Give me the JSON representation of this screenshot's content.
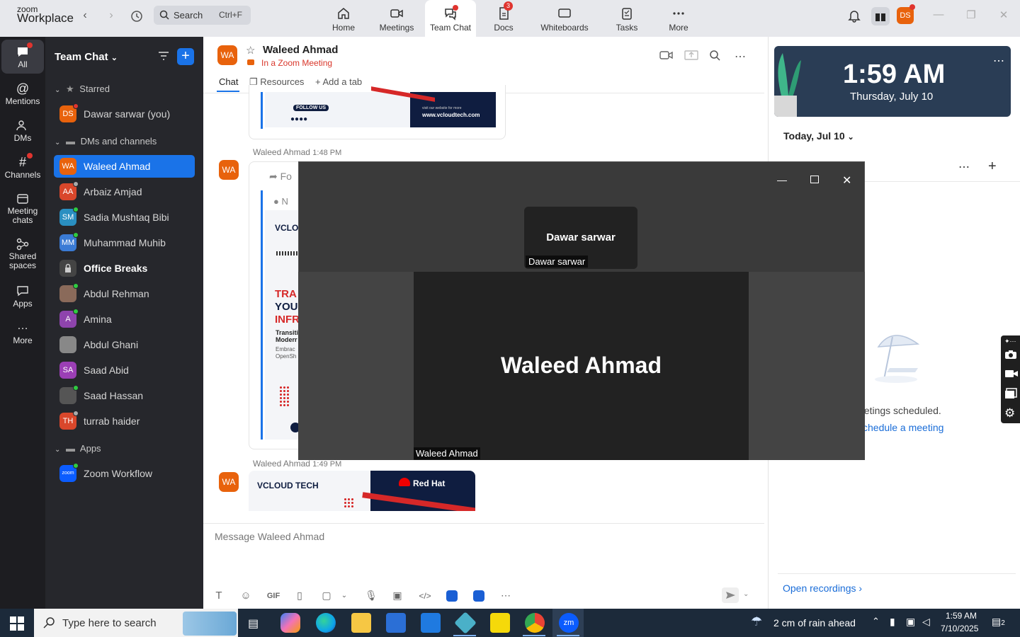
{
  "app": {
    "brand_small": "zoom",
    "brand_large": "Workplace"
  },
  "search": {
    "label": "Search",
    "shortcut": "Ctrl+F"
  },
  "nav_tabs": [
    {
      "label": "Home",
      "icon": "home-icon"
    },
    {
      "label": "Meetings",
      "icon": "video-icon"
    },
    {
      "label": "Team Chat",
      "icon": "chat-icon",
      "active": true
    },
    {
      "label": "Docs",
      "icon": "docs-icon",
      "badge": "3"
    },
    {
      "label": "Whiteboards",
      "icon": "whiteboard-icon"
    },
    {
      "label": "Tasks",
      "icon": "tasks-icon"
    },
    {
      "label": "More",
      "icon": "more-icon"
    }
  ],
  "profile": {
    "initials": "DS"
  },
  "rail": [
    {
      "label": "All",
      "icon": "chat-bubble-icon"
    },
    {
      "label": "Mentions",
      "icon": "at-icon"
    },
    {
      "label": "DMs",
      "icon": "people-icon"
    },
    {
      "label": "Channels",
      "icon": "hash-icon"
    },
    {
      "label": "Meeting chats",
      "icon": "calendar-icon"
    },
    {
      "label": "Shared spaces",
      "icon": "share-icon"
    },
    {
      "label": "Apps",
      "icon": "apps-icon"
    },
    {
      "label": "More",
      "icon": "ellipsis-icon"
    }
  ],
  "sidebar": {
    "title": "Team Chat",
    "starred_label": "Starred",
    "starred": [
      {
        "name": "Dawar sarwar (you)",
        "initials": "DS",
        "color": "#e8620c"
      }
    ],
    "dms_label": "DMs and channels",
    "dms": [
      {
        "name": "Waleed Ahmad",
        "initials": "WA",
        "color": "#e8620c",
        "selected": true
      },
      {
        "name": "Arbaiz Amjad",
        "initials": "AA",
        "color": "#d9472b"
      },
      {
        "name": "Sadia Mushtaq Bibi",
        "initials": "SM",
        "color": "#2a8fc1"
      },
      {
        "name": "Muhammad Muhib",
        "initials": "MM",
        "color": "#3a7bd5"
      },
      {
        "name": "Office Breaks",
        "initials": "",
        "color": "#555",
        "bold": true
      },
      {
        "name": "Abdul Rehman",
        "initials": "",
        "color": "#8a6a5a"
      },
      {
        "name": "Amina",
        "initials": "A",
        "color": "#8e44ad"
      },
      {
        "name": "Abdul Ghani",
        "initials": "",
        "color": "#777"
      },
      {
        "name": "Saad Abid",
        "initials": "SA",
        "color": "#9b3fb5"
      },
      {
        "name": "Saad Hassan",
        "initials": "",
        "color": "#666"
      },
      {
        "name": "turrab haider",
        "initials": "TH",
        "color": "#d9472b"
      }
    ],
    "apps_label": "Apps",
    "apps": [
      {
        "name": "Zoom Workflow",
        "initials": "zoom",
        "color": "#0b5cff"
      }
    ]
  },
  "chat": {
    "contact_initials": "WA",
    "contact_name": "Waleed Ahmad",
    "contact_status": "In a Zoom Meeting",
    "tabs": {
      "chat": "Chat",
      "resources": "Resources",
      "add": "Add a tab"
    },
    "messages": [
      {
        "sender": "Waleed Ahmad",
        "time": "1:48 PM",
        "forward_text": "Fo"
      },
      {
        "sender": "Waleed Ahmad",
        "time": "1:49 PM"
      }
    ],
    "card_texts": {
      "follow_us": "FOLLOW US",
      "website_small": "visit our website for more",
      "website": "www.vcloudtech.com",
      "brand": "VCLOUD TECH",
      "brand_partial": "VCLO",
      "redhat": "Red Hat",
      "headline_1": "TRA",
      "headline_2": "YOU",
      "headline_3": "INFR",
      "body_1": "Transiti",
      "body_2": "Moderr",
      "body_3": "Embrac",
      "body_4": "OpenSh",
      "n_label": "N"
    },
    "composer_placeholder": "Message Waleed Ahmad",
    "composer_tools": {
      "gif": "GIF"
    }
  },
  "right_panel": {
    "time": "1:59 AM",
    "date": "Thursday, July 10",
    "today_label": "Today, Jul 10",
    "no_meetings": "eetings scheduled.",
    "schedule_link": "chedule a meeting",
    "open_recordings": "Open recordings"
  },
  "video_window": {
    "mini_name": "Dawar sarwar",
    "mini_tag": "Dawar sarwar",
    "main_name": "Waleed Ahmad",
    "main_tag": "Waleed Ahmad"
  },
  "taskbar": {
    "search_placeholder": "Type here to search",
    "weather": "2 cm of rain ahead",
    "time": "1:59 AM",
    "date": "7/10/2025",
    "notification_count": "2"
  }
}
